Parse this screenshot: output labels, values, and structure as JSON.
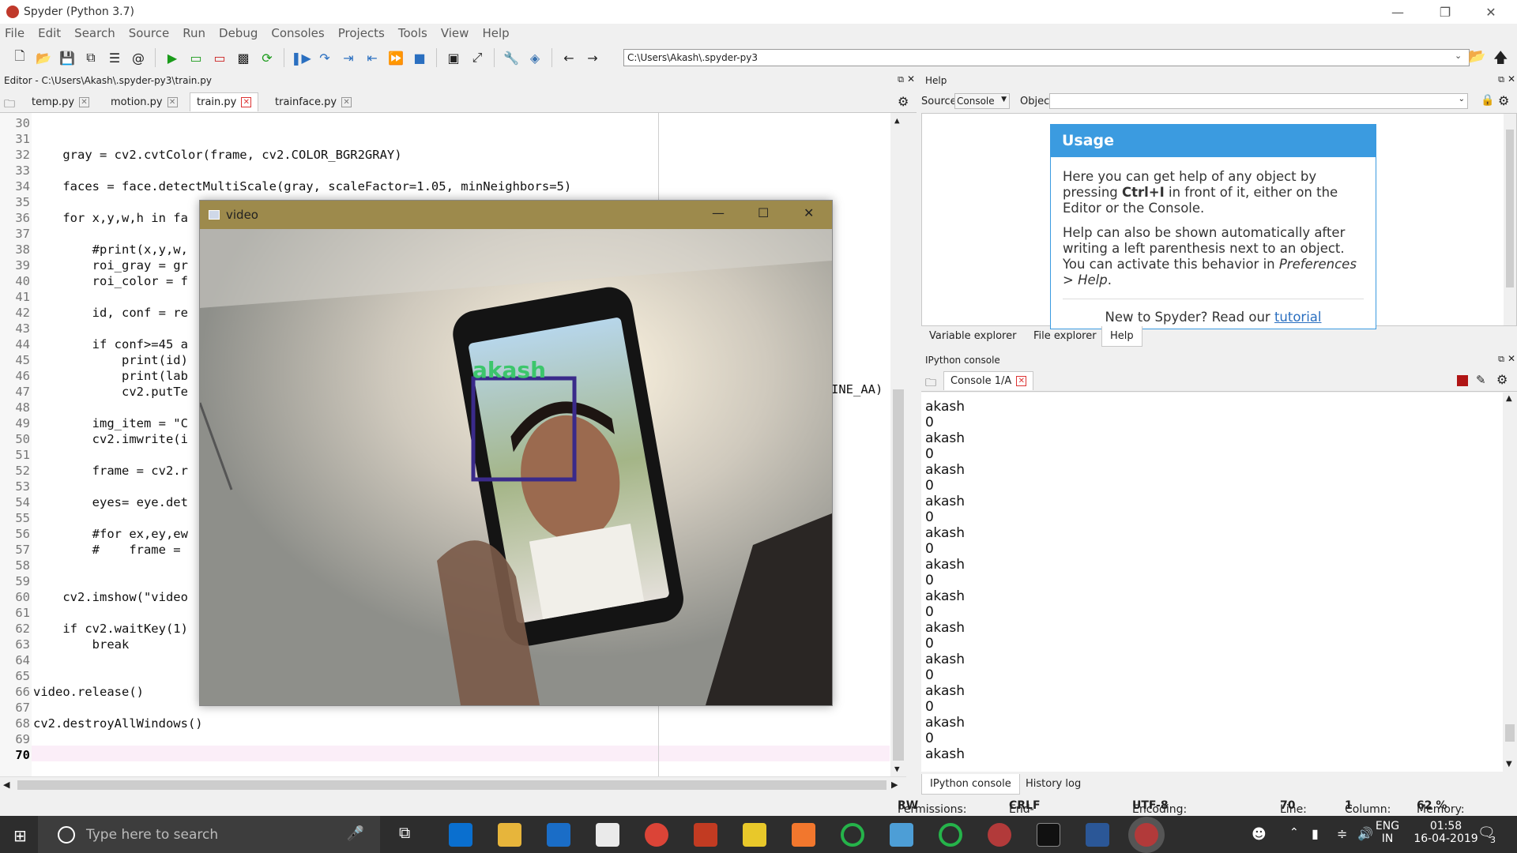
{
  "window": {
    "title": "Spyder (Python 3.7)"
  },
  "menu": [
    "File",
    "Edit",
    "Search",
    "Source",
    "Run",
    "Debug",
    "Consoles",
    "Projects",
    "Tools",
    "View",
    "Help"
  ],
  "toolbar": {
    "path": "C:\\Users\\Akash\\.spyder-py3"
  },
  "editor": {
    "header": "Editor - C:\\Users\\Akash\\.spyder-py3\\train.py",
    "tabs": [
      "temp.py",
      "motion.py",
      "train.py",
      "trainface.py"
    ],
    "active_tab": "train.py",
    "lines": [
      {
        "n": "30",
        "t": ""
      },
      {
        "n": "31",
        "t": ""
      },
      {
        "n": "32",
        "t": "    gray = cv2.cvtColor(frame, cv2.COLOR_BGR2GRAY)"
      },
      {
        "n": "33",
        "t": ""
      },
      {
        "n": "34",
        "t": "    faces = face.detectMultiScale(gray, scaleFactor=1.05, minNeighbors=5)"
      },
      {
        "n": "35",
        "t": ""
      },
      {
        "n": "36",
        "t": "    for x,y,w,h in fa"
      },
      {
        "n": "37",
        "t": ""
      },
      {
        "n": "38",
        "t": "        #print(x,y,w,"
      },
      {
        "n": "39",
        "t": "        roi_gray = gr"
      },
      {
        "n": "40",
        "t": "        roi_color = f"
      },
      {
        "n": "41",
        "t": ""
      },
      {
        "n": "42",
        "t": "        id, conf = re"
      },
      {
        "n": "43",
        "t": ""
      },
      {
        "n": "44",
        "t": "        if conf>=45 a"
      },
      {
        "n": "45",
        "t": "            print(id)"
      },
      {
        "n": "46",
        "t": "            print(lab"
      },
      {
        "n": "47",
        "t": "            cv2.putTe"
      },
      {
        "n": "48",
        "t": ""
      },
      {
        "n": "49",
        "t": "        img_item = \"C"
      },
      {
        "n": "50",
        "t": "        cv2.imwrite(i"
      },
      {
        "n": "51",
        "t": ""
      },
      {
        "n": "52",
        "t": "        frame = cv2.r"
      },
      {
        "n": "53",
        "t": ""
      },
      {
        "n": "54",
        "t": "        eyes= eye.det"
      },
      {
        "n": "55",
        "t": ""
      },
      {
        "n": "56",
        "t": "        #for ex,ey,ew"
      },
      {
        "n": "57",
        "t": "        #    frame = "
      },
      {
        "n": "58",
        "t": ""
      },
      {
        "n": "59",
        "t": ""
      },
      {
        "n": "60",
        "t": "    cv2.imshow(\"video"
      },
      {
        "n": "61",
        "t": ""
      },
      {
        "n": "62",
        "t": "    if cv2.waitKey(1)"
      },
      {
        "n": "63",
        "t": "        break"
      },
      {
        "n": "64",
        "t": ""
      },
      {
        "n": "65",
        "t": ""
      },
      {
        "n": "66",
        "t": "video.release()"
      },
      {
        "n": "67",
        "t": ""
      },
      {
        "n": "68",
        "t": "cv2.destroyAllWindows()"
      },
      {
        "n": "69",
        "t": ""
      },
      {
        "n": "70",
        "t": ""
      }
    ],
    "line47_tail": "INE_AA)"
  },
  "video_window": {
    "title": "video",
    "overlay_label": "akash"
  },
  "help": {
    "header": "Help",
    "source_label": "Source",
    "source_value": "Console",
    "object_label": "Object",
    "usage_title": "Usage",
    "p1_a": "Here you can get help of any object by pressing ",
    "p1_b": "Ctrl+I",
    "p1_c": " in front of it, either on the Editor or the Console.",
    "p2_a": "Help can also be shown automatically after writing a left parenthesis next to an object. You can activate this behavior in ",
    "p2_b": "Preferences > Help",
    "p2_c": ".",
    "new_text": "New to Spyder? Read our ",
    "tutorial_link": "tutorial",
    "tabs": [
      "Variable explorer",
      "File explorer",
      "Help"
    ]
  },
  "console": {
    "header": "IPython console",
    "tab": "Console 1/A",
    "lines": [
      "akash",
      "0",
      "akash",
      "0",
      "akash",
      "0",
      "akash",
      "0",
      "akash",
      "0",
      "akash",
      "0",
      "akash",
      "0",
      "akash",
      "0",
      "akash",
      "0",
      "akash",
      "0",
      "akash",
      "0",
      "akash"
    ],
    "bottom_tabs": [
      "IPython console",
      "History log"
    ]
  },
  "status": {
    "permissions_label": "Permissions:",
    "permissions": "RW",
    "eol_label": "End-of-lines:",
    "eol": "CRLF",
    "encoding_label": "Encoding:",
    "encoding": "UTF-8",
    "line_label": "Line:",
    "line": "70",
    "column_label": "Column:",
    "column": "1",
    "memory_label": "Memory:",
    "memory": "62 %"
  },
  "taskbar": {
    "search_placeholder": "Type here to search",
    "lang_top": "ENG",
    "lang_bottom": "IN",
    "time": "01:58",
    "date": "16-04-2019",
    "notification_count": "3"
  }
}
